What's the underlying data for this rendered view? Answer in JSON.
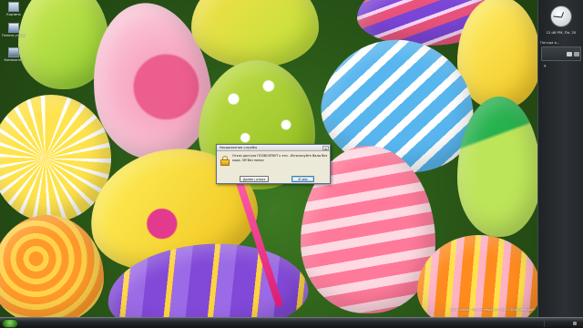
{
  "desktop": {
    "icons": [
      {
        "label": "Корзина",
        "icon": "recycle-bin-icon"
      },
      {
        "label": "Панель управления",
        "icon": "control-panel-icon"
      },
      {
        "label": "Компьютер",
        "icon": "computer-icon"
      }
    ],
    "wallpaper_caption": "Фотографии ТЕ1 Колледжа и Фейт: \"Дизайнерский\""
  },
  "sidebar": {
    "clock_time": "12:46 PM, Пн, 20",
    "gadget_title": "Погода в...",
    "icons": [
      "gadget-icon",
      "gadget-settings-icon"
    ]
  },
  "dialog": {
    "title": "Уведомление службы",
    "close_glyph": "×",
    "message": "Отказ доступа ПОЗВОЛЯЮТ к эти - Используйте Валы без кода. Off без папки",
    "buttons": {
      "cancel": "Далее / отказ",
      "ok": "В чем"
    },
    "icon": "lock-icon"
  },
  "taskbar": {
    "start_icon": "start-orb-icon",
    "tray_icon": "tray-icon"
  },
  "colors": {
    "dialog_bg": "#ece9d8",
    "sidebar_bg": "#2c3135",
    "taskbar_bg": "#23272b",
    "accent": "#3c7fb1"
  }
}
